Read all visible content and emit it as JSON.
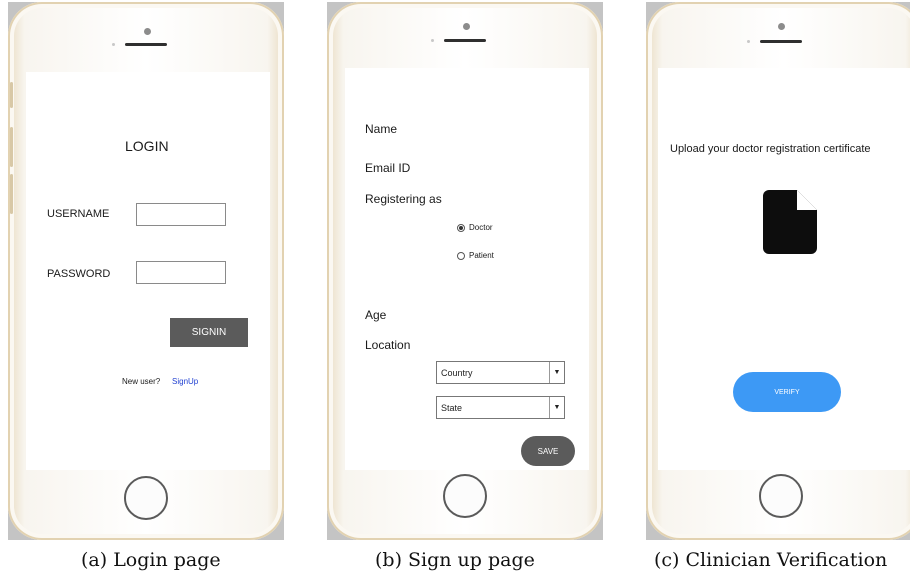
{
  "login": {
    "title": "LOGIN",
    "username_label": "USERNAME",
    "username_value": "",
    "password_label": "PASSWORD",
    "password_value": "",
    "signin_button": "SIGNIN",
    "new_user_text": "New user?",
    "signup_link": "SignUp",
    "caption": "(a) Login page"
  },
  "signup": {
    "name_label": "Name",
    "email_label": "Email ID",
    "registering_label": "Registering as",
    "options": [
      {
        "label": "Doctor",
        "selected": true
      },
      {
        "label": "Patient",
        "selected": false
      }
    ],
    "age_label": "Age",
    "location_label": "Location",
    "country_select": "Country",
    "state_select": "State",
    "save_button": "SAVE",
    "caption": "(b) Sign up page"
  },
  "verify": {
    "instruction": "Upload your doctor registration certificate",
    "file_icon": "file-icon",
    "verify_button": "VERIFY",
    "caption": "(c) Clinician Verification"
  },
  "colors": {
    "dark_button": "#5b5b5b",
    "verify_blue": "#3d99f5",
    "signup_link": "#1f3fd1",
    "phone_gold": "#e2d2b1"
  }
}
